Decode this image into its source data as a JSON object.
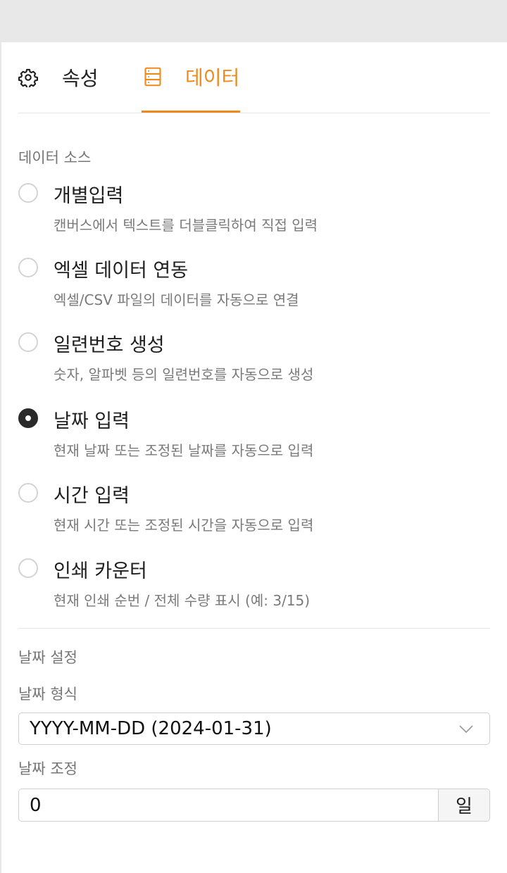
{
  "tabs": {
    "properties": {
      "label": "속성",
      "icon": "gear-icon"
    },
    "data": {
      "label": "데이터",
      "icon": "database-icon",
      "active": true
    }
  },
  "data_source": {
    "title": "데이터 소스",
    "options": [
      {
        "title": "개별입력",
        "desc": "캔버스에서 텍스트를 더블클릭하여 직접 입력",
        "checked": false
      },
      {
        "title": "엑셀 데이터 연동",
        "desc": "엑셀/CSV 파일의 데이터를 자동으로 연결",
        "checked": false
      },
      {
        "title": "일련번호 생성",
        "desc": "숫자, 알파벳 등의 일련번호를 자동으로 생성",
        "checked": false
      },
      {
        "title": "날짜 입력",
        "desc": "현재 날짜 또는 조정된 날짜를 자동으로 입력",
        "checked": true
      },
      {
        "title": "시간 입력",
        "desc": "현재 시간 또는 조정된 시간을 자동으로 입력",
        "checked": false
      },
      {
        "title": "인쇄 카운터",
        "desc": "현재 인쇄 순번 / 전체 수량 표시 (예: 3/15)",
        "checked": false
      }
    ]
  },
  "date_settings": {
    "title": "날짜 설정",
    "format_label": "날짜 형식",
    "format_value": "YYYY-MM-DD (2024-01-31)",
    "adjust_label": "날짜 조정",
    "adjust_value": "0",
    "adjust_unit": "일"
  },
  "colors": {
    "accent": "#ee8a1b",
    "text": "#1f1f1f",
    "muted": "#7a7a7a"
  }
}
